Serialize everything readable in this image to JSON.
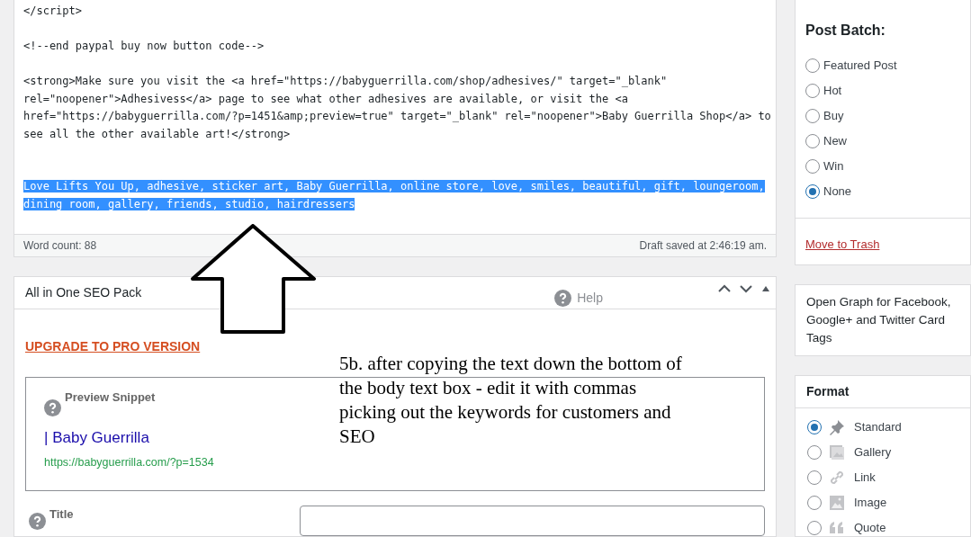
{
  "editor": {
    "blocks": [
      {
        "lines": [
          "</script>"
        ],
        "selected": false
      },
      {
        "lines": [
          "<!--end paypal buy now button code-->"
        ],
        "selected": false
      },
      {
        "lines": [
          "<strong>Make sure you visit the <a href=\"https://babyguerrilla.com/shop/adhesives/\" target=\"_blank\"",
          "rel=\"noopener\">Adhesivess</a> page to see what other adhesives are available, or visit the <a",
          "href=\"https://babyguerrilla.com/?p=1451&amp;preview=true\" target=\"_blank\" rel=\"noopener\">Baby Guerrilla Shop</a> to",
          "see all the other available art!</strong>"
        ],
        "selected": false
      },
      {
        "lines": [
          "Love Lifts You Up, adhesive, sticker art, Baby Guerrilla, online store, love, smiles, beautiful, gift, loungeroom,",
          "dining room, gallery, friends, studio, hairdressers"
        ],
        "selected": true
      }
    ],
    "word_count": "Word count: 88",
    "draft_status": "Draft saved at 2:46:19 am."
  },
  "seo_panel": {
    "title": "All in One SEO Pack",
    "help": "Help",
    "upgrade_link": "UPGRADE TO PRO VERSION",
    "preview": {
      "label": "Preview Snippet",
      "title": "| Baby Guerrilla",
      "url": "https://babyguerrilla.com/?p=1534"
    },
    "title_field": {
      "label": "Title"
    }
  },
  "annotation": "5b. after copying the text down the bottom of the body text box - edit it with commas picking out the keywords for customers and SEO",
  "post_batch": {
    "title": "Post Batch:",
    "options": [
      {
        "label": "Featured Post",
        "selected": false
      },
      {
        "label": "Hot",
        "selected": false
      },
      {
        "label": "Buy",
        "selected": false
      },
      {
        "label": "New",
        "selected": false
      },
      {
        "label": "Win",
        "selected": false
      },
      {
        "label": "None",
        "selected": true
      }
    ],
    "trash_link": "Move to Trash"
  },
  "open_graph": {
    "title": "Open Graph for Facebook, Google+ and Twitter Card Tags"
  },
  "format": {
    "title": "Format",
    "options": [
      {
        "label": "Standard",
        "kind": "pin",
        "selected": true
      },
      {
        "label": "Gallery",
        "kind": "gallery",
        "selected": false
      },
      {
        "label": "Link",
        "kind": "link",
        "selected": false
      },
      {
        "label": "Image",
        "kind": "image",
        "selected": false
      },
      {
        "label": "Quote",
        "kind": "quote",
        "selected": false
      }
    ]
  }
}
